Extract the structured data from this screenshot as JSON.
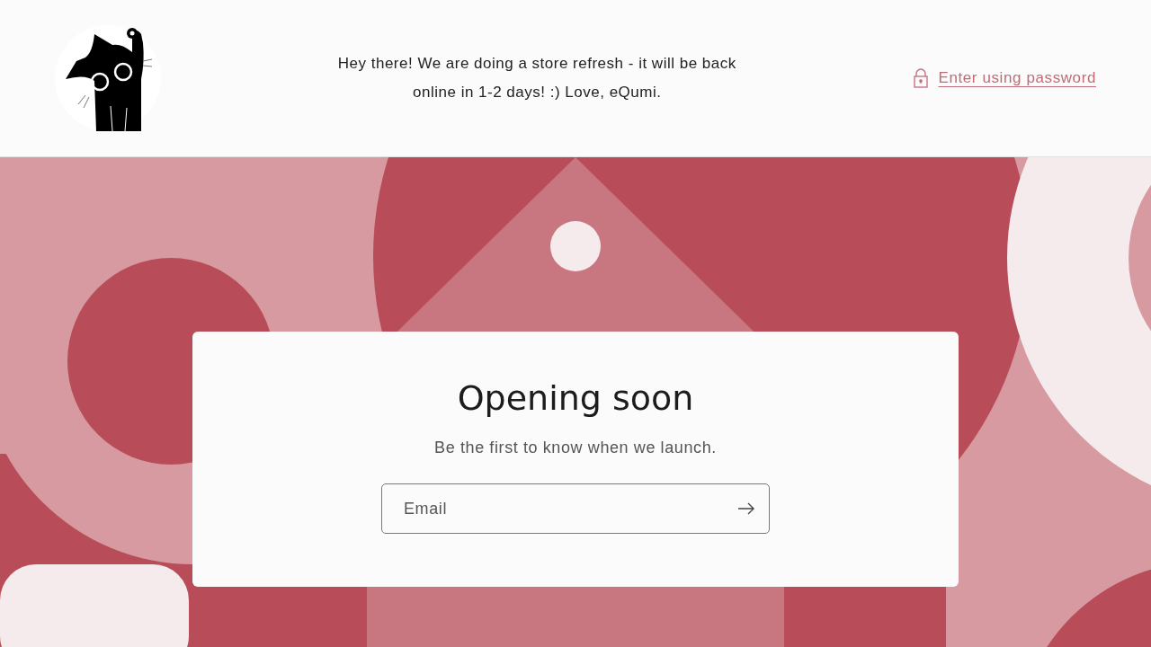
{
  "header": {
    "announcement": "Hey there! We are doing a store refresh - it will be back online in 1-2 days! :) Love, eQumi.",
    "password_link": "Enter using password"
  },
  "card": {
    "title": "Opening soon",
    "subtitle": "Be the first to know when we launch.",
    "email": {
      "placeholder": "Email"
    }
  }
}
